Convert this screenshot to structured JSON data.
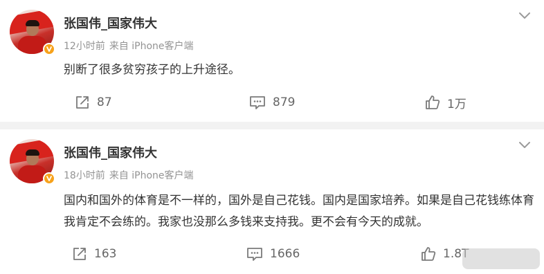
{
  "posts": [
    {
      "username": "张国伟_国家伟大",
      "time": "12小时前",
      "source": "来自 iPhone客户端",
      "content": "别断了很多贫穷孩子的上升途径。",
      "reposts": "87",
      "comments": "879",
      "likes": "1万",
      "verified_color": "#f7a21b"
    },
    {
      "username": "张国伟_国家伟大",
      "time": "18小时前",
      "source": "来自 iPhone客户端",
      "content": "国内和国外的体育是不一样的，国外是自己花钱。国内是国家培养。如果是自己花钱练体育我肯定不会练的。我家也没那么多钱来支持我。更不会有今天的成就。",
      "reposts": "163",
      "comments": "1666",
      "likes": "1.8T",
      "verified_color": "#f7a21b"
    }
  ],
  "icons": {
    "repost": "repost-icon",
    "comment": "comment-icon",
    "like": "like-icon",
    "more": "chevron-down-icon",
    "verified": "verified-badge-icon"
  }
}
